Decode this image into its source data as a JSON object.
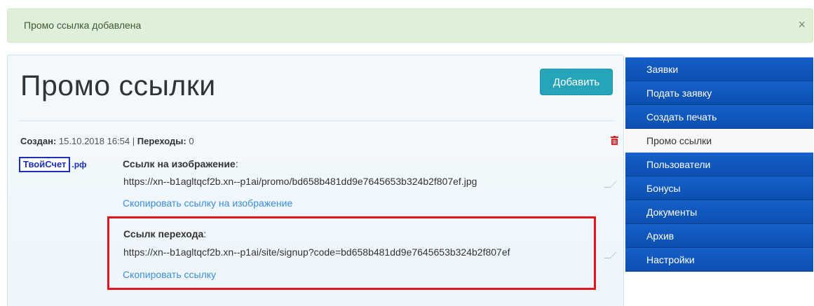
{
  "alert": {
    "message": "Промо ссылка добавлена",
    "close_symbol": "×"
  },
  "page": {
    "title": "Промо ссылки",
    "add_button": "Добавить"
  },
  "entry": {
    "created_label": "Создан:",
    "created_value": "15.10.2018 16:54",
    "separator": "|",
    "clicks_label": "Переходы:",
    "clicks_value": "0",
    "logo_text": "ТвойСчет",
    "logo_suffix": ".рф",
    "image_link": {
      "label": "Ссылк на изображение",
      "colon": ":",
      "url": "https://xn--b1agltqcf2b.xn--p1ai/promo/bd658b481dd9e7645653b324b2f807ef.jpg",
      "copy_text": "Скопировать ссылку на изображение"
    },
    "signup_link": {
      "label": "Ссылк перехода",
      "colon": ":",
      "url": "https://xn--b1agltqcf2b.xn--p1ai/site/signup?code=bd658b481dd9e7645653b324b2f807ef",
      "copy_text": "Скопировать ссылку"
    }
  },
  "sidebar": {
    "items": [
      {
        "label": "Заявки",
        "active": false
      },
      {
        "label": "Подать заявку",
        "active": false
      },
      {
        "label": "Создать печать",
        "active": false
      },
      {
        "label": "Промо ссылки",
        "active": true
      },
      {
        "label": "Пользователи",
        "active": false
      },
      {
        "label": "Бонусы",
        "active": false
      },
      {
        "label": "Документы",
        "active": false
      },
      {
        "label": "Архив",
        "active": false
      },
      {
        "label": "Настройки",
        "active": false
      }
    ]
  },
  "colors": {
    "accent": "#26a4b9",
    "sidebar": "#1560c9",
    "link": "#3a8dde",
    "alert_bg": "#dff0d8",
    "highlight": "#e3141c",
    "trash": "#e3141c"
  },
  "icons": {
    "trash": "trash-icon",
    "close": "close-icon"
  }
}
